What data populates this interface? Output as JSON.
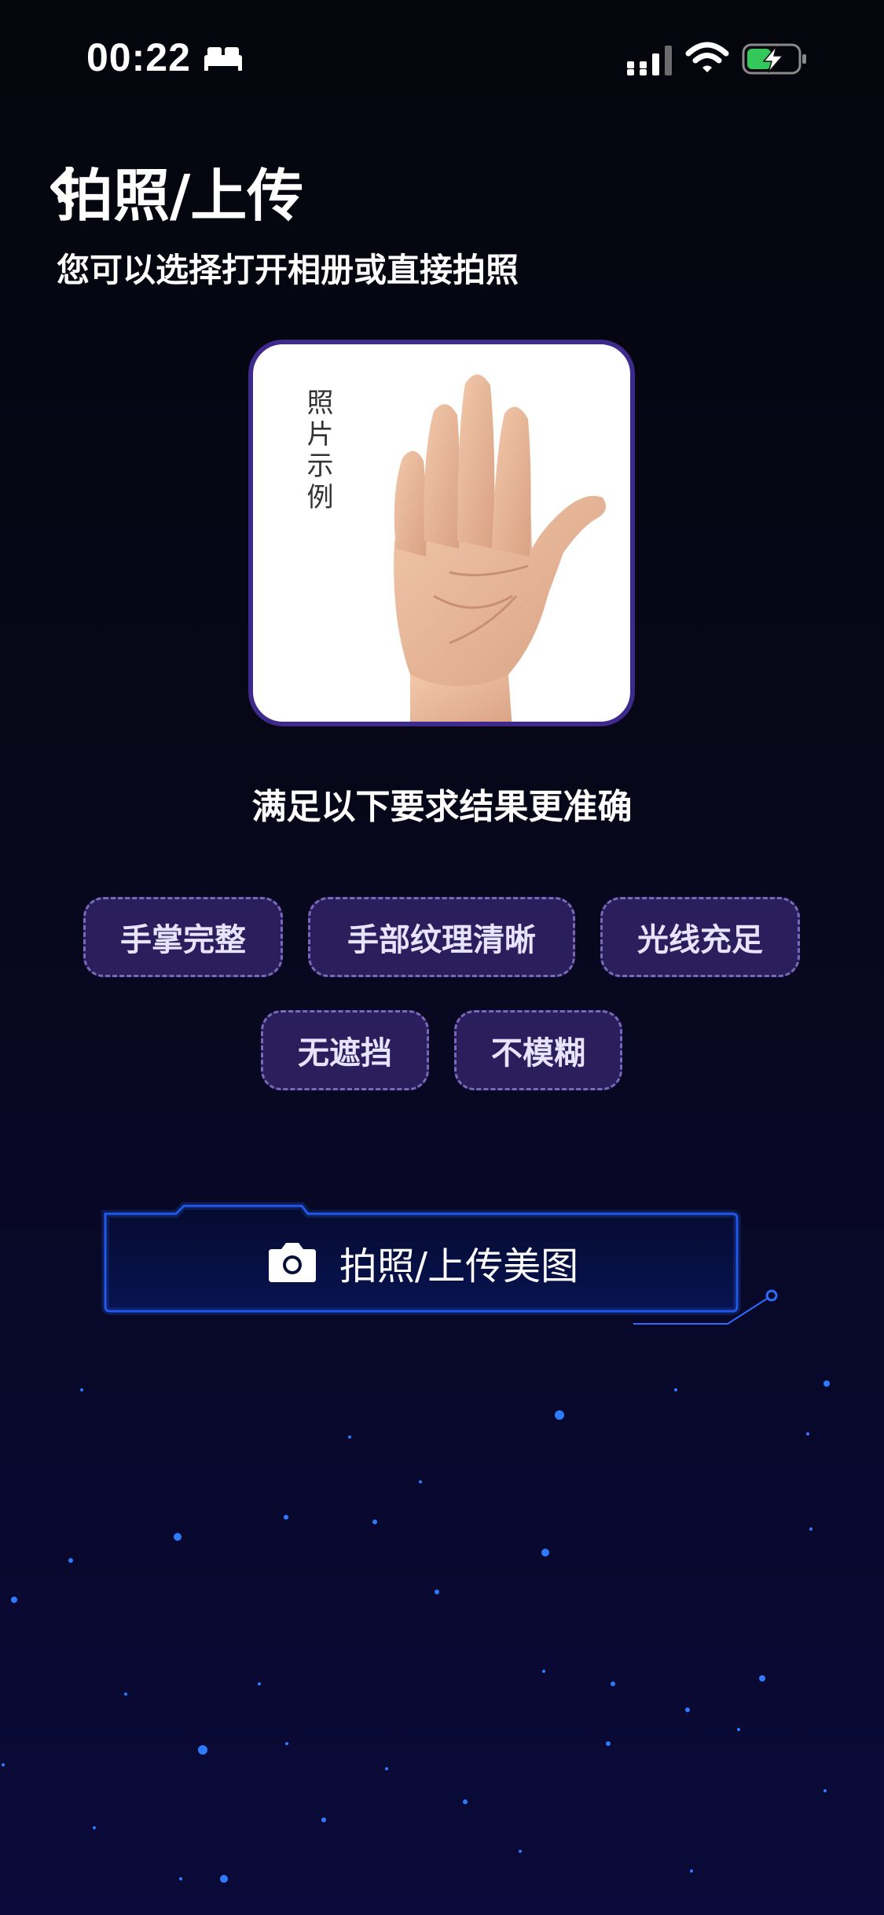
{
  "status_bar": {
    "time": "00:22",
    "icons": [
      "bed-icon",
      "signal-icon",
      "wifi-icon",
      "battery-charging-icon"
    ],
    "battery_color": "#34c759"
  },
  "header": {
    "back_icon": "chevron-left-icon",
    "title": "拍照/上传",
    "subtitle": "您可以选择打开相册或直接拍照"
  },
  "sample": {
    "caption": "照片示例",
    "image": "palm-hand-photo"
  },
  "requirements": {
    "heading": "满足以下要求结果更准确",
    "tags": [
      "手掌完整",
      "手部纹理清晰",
      "光线充足",
      "无遮挡",
      "不模糊"
    ]
  },
  "upload_button": {
    "icon": "camera-icon",
    "label": "拍照/上传美图"
  },
  "colors": {
    "background": "#06061a",
    "accent": "#2f6bff",
    "tag_fill": "#2a1f5c",
    "tag_border": "#7a68b8",
    "card_border": "#3d2a8a"
  }
}
